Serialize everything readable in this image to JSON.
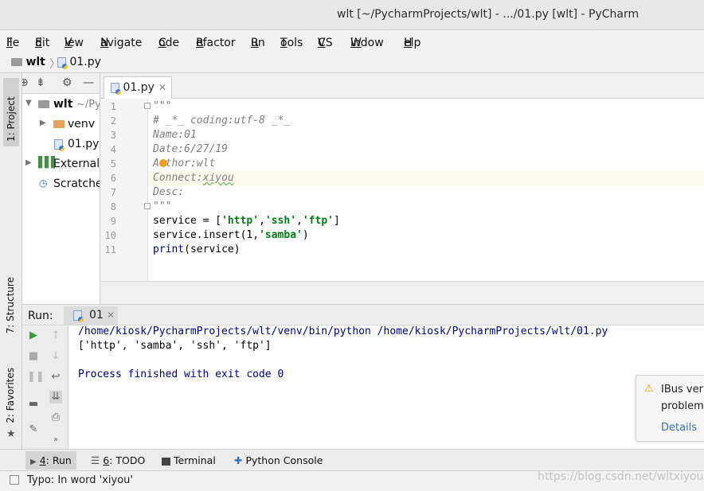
{
  "window": {
    "title": "wlt [~/PycharmProjects/wlt] - .../01.py [wlt] - PyCharm"
  },
  "menu": [
    {
      "u": "F",
      "rest": "ile"
    },
    {
      "u": "E",
      "rest": "dit"
    },
    {
      "u": "V",
      "rest": "iew"
    },
    {
      "u": "N",
      "rest": "avigate"
    },
    {
      "u": "C",
      "rest": "ode"
    },
    {
      "u": "R",
      "rest": "efactor"
    },
    {
      "u": "R",
      "rest": "un"
    },
    {
      "u": "T",
      "rest": "ools"
    },
    {
      "u": "V",
      "rest": "CS"
    },
    {
      "u": "W",
      "rest": "indow"
    },
    {
      "u": "H",
      "rest": "elp"
    }
  ],
  "breadcrumb": {
    "project": "wlt",
    "file": "01.py"
  },
  "left_strip": {
    "project": "1: Project",
    "structure": "7: Structure",
    "favorites": "2: Favorites"
  },
  "tree": {
    "root": "wlt",
    "root_path": "~/Py",
    "venv": "venv",
    "file": "01.py",
    "external": "External",
    "scratches": "Scratche"
  },
  "editor": {
    "tab": "01.py",
    "lines": [
      "1",
      "2",
      "3",
      "4",
      "5",
      "6",
      "7",
      "8",
      "9",
      "10",
      "11"
    ],
    "code": {
      "l1": "\"\"\"",
      "l2": "# _*_ coding:utf-8 _*_",
      "l3": "Name:01",
      "l4": "Date:6/27/19",
      "l5": "Author:wlt",
      "l6a": "Connect:",
      "l6b": "xiyou",
      "l7": "Desc:",
      "l8": "\"\"\"",
      "l9a": "service = [",
      "l9s1": "'http'",
      "l9c1": ",",
      "l9s2": "'ssh'",
      "l9c2": ",",
      "l9s3": "'ftp'",
      "l9b": "]",
      "l10a": "service.insert(1,",
      "l10s": "'samba'",
      "l10b": ")",
      "l11a": "print",
      "l11b": "(service)"
    }
  },
  "run": {
    "label": "Run:",
    "tab": "01",
    "output": [
      "/home/kiosk/PycharmProjects/wlt/venv/bin/python /home/kiosk/PycharmProjects/wlt/01.py",
      "['http', 'samba', 'ssh', 'ftp']",
      "Process finished with exit code 0"
    ]
  },
  "notification": {
    "line1": "IBus ver",
    "line2": "problem",
    "link": "Details"
  },
  "bottom_tabs": {
    "run_num": "4",
    "run": ": Run",
    "todo_num": "6",
    "todo": ": TODO",
    "terminal": "Terminal",
    "python_console": "Python Console"
  },
  "status": {
    "message": "Typo: In word 'xiyou'"
  },
  "watermark": "https://blog.csdn.net/wltxiyou",
  "colors": {
    "string": "#067d17",
    "comment": "#808080",
    "console_text": "#000080",
    "link": "#3a6ec2"
  }
}
